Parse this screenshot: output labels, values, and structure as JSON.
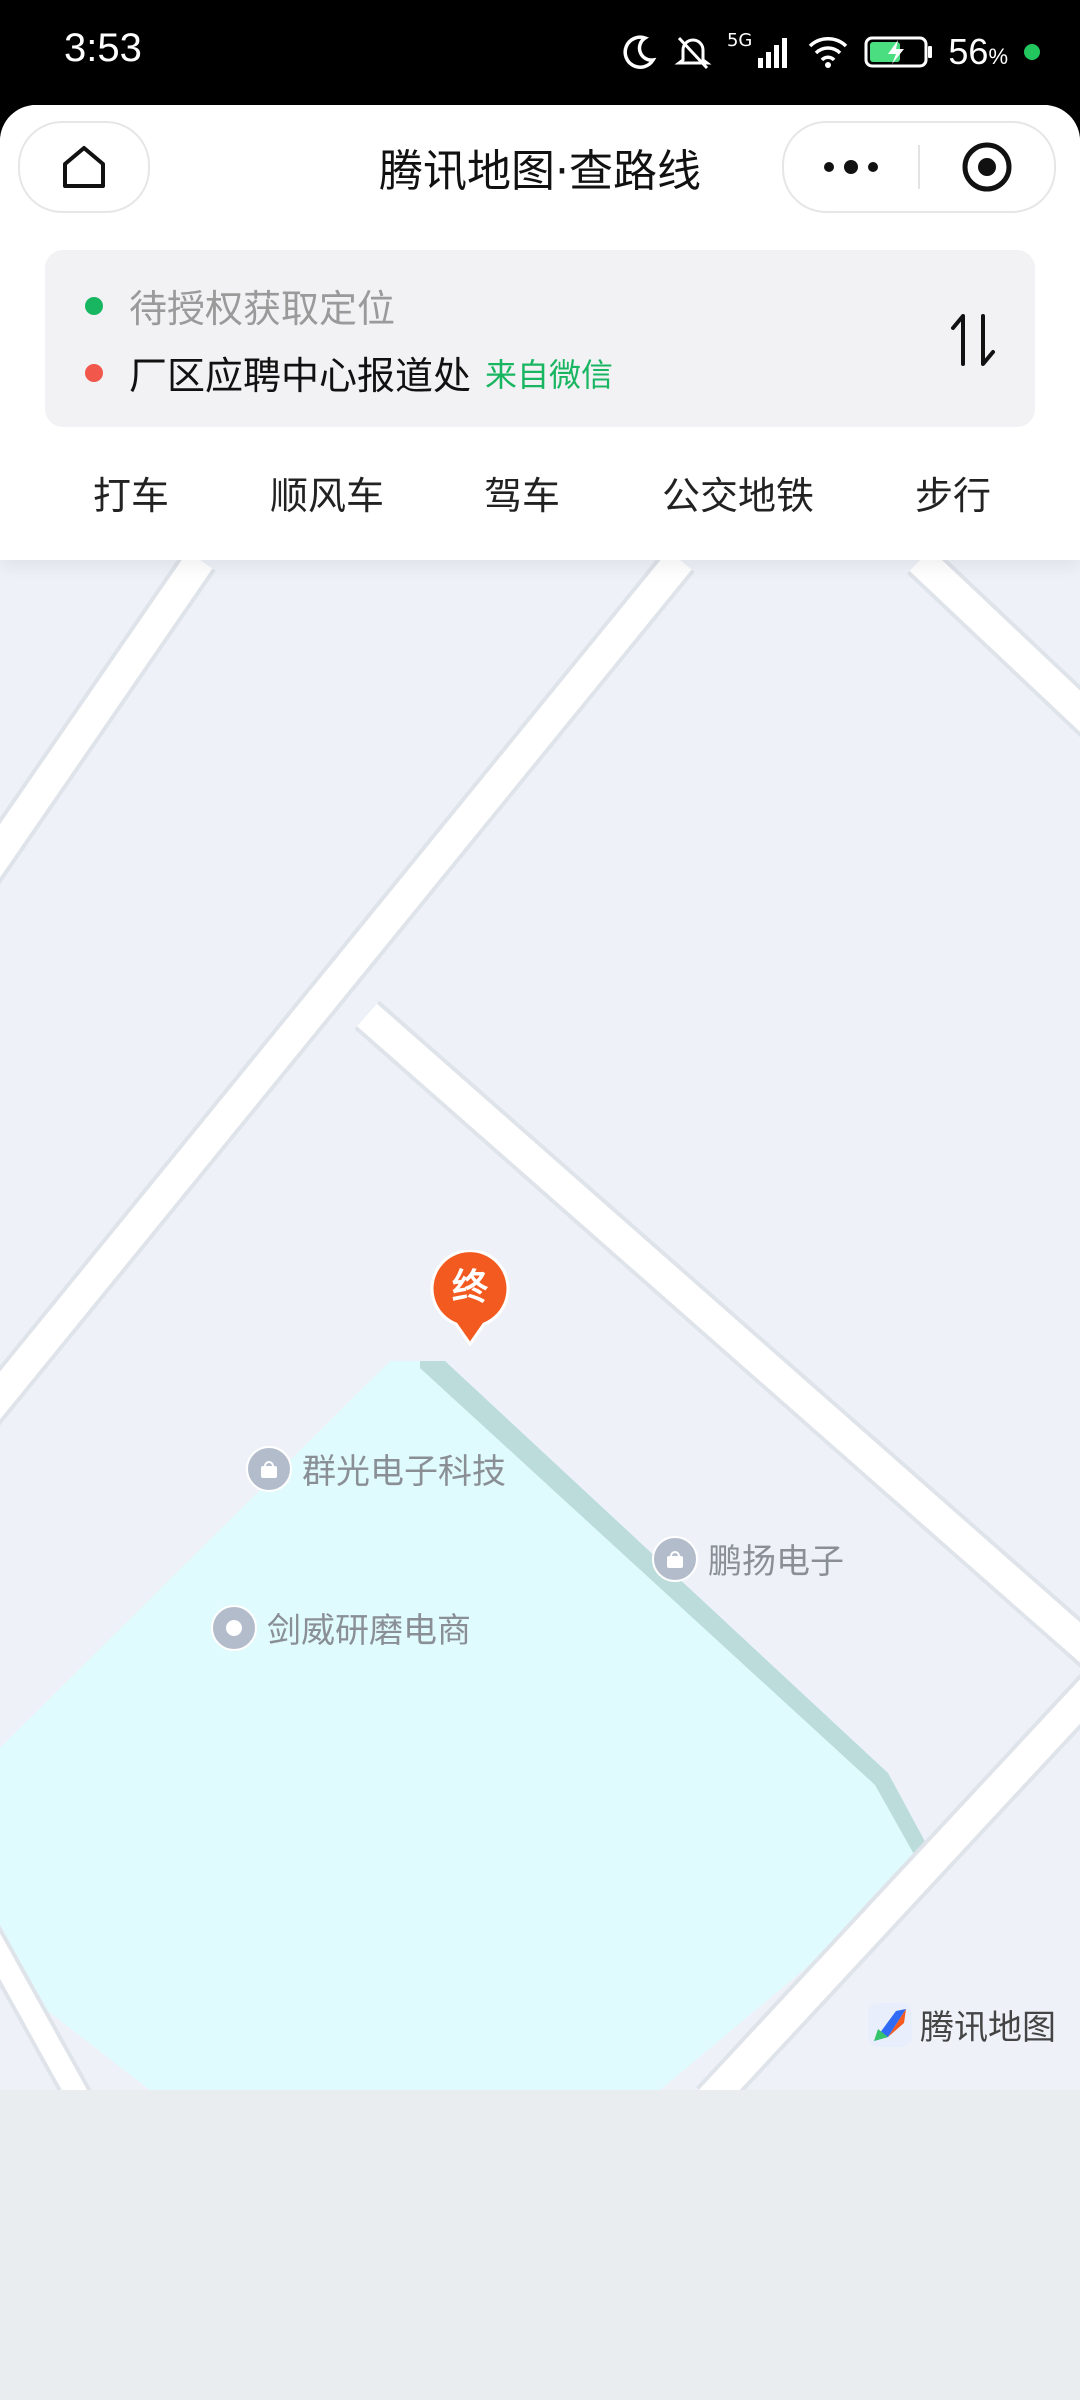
{
  "status": {
    "time": "3:53",
    "network": "5G",
    "battery": "56",
    "battery_unit": "%"
  },
  "nav": {
    "title": "腾讯地图·查路线"
  },
  "route": {
    "start_text": "待授权获取定位",
    "end_text": "厂区应聘中心报道处",
    "end_source": "来自微信",
    "start_color": "#19b661",
    "end_color": "#f2574b"
  },
  "tabs": [
    {
      "label": "打车"
    },
    {
      "label": "顺风车"
    },
    {
      "label": "驾车"
    },
    {
      "label": "公交地铁"
    },
    {
      "label": "步行"
    }
  ],
  "map": {
    "end_marker_label": "终",
    "pois": [
      {
        "label": "群光电子科技",
        "icon": "shopping-bag-icon"
      },
      {
        "label": "鹏扬电子",
        "icon": "shopping-bag-icon"
      },
      {
        "label": "剑威研磨电商",
        "icon": "dot-icon"
      }
    ],
    "logo_text": "腾讯地图"
  },
  "colors": {
    "accent_green": "#19b661",
    "marker_orange": "#f25a1f",
    "map_bg": "#eef2f8",
    "area_fill": "#e0fbfd"
  }
}
